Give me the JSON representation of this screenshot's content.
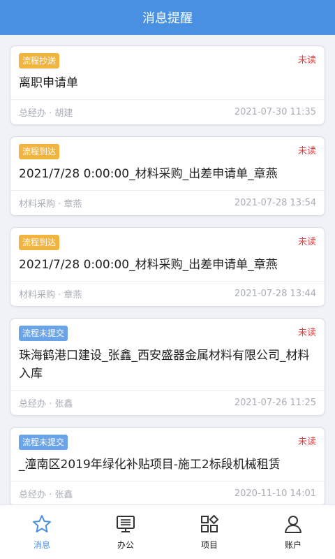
{
  "header": {
    "title": "消息提醒"
  },
  "messages": [
    {
      "tag": "流程抄送",
      "tag_color": "#f2b441",
      "status": "未读",
      "title": "离职申请单",
      "meta": "总经办 · 胡建",
      "time": "2021-07-30 11:35"
    },
    {
      "tag": "流程到达",
      "tag_color": "#f2b441",
      "status": "未读",
      "title": "2021/7/28 0:00:00_材料采购_出差申请单_章燕",
      "meta": "材料采购 · 章燕",
      "time": "2021-07-28 13:54"
    },
    {
      "tag": "流程到达",
      "tag_color": "#f2b441",
      "status": "未读",
      "title": "2021/7/28 0:00:00_材料采购_出差申请单_章燕",
      "meta": "材料采购 · 章燕",
      "time": "2021-07-28 13:44"
    },
    {
      "tag": "流程未提交",
      "tag_color": "#6aa3e8",
      "status": "未读",
      "title": "珠海鹤港口建设_张鑫_西安盛器金属材料有限公司_材料入库",
      "meta": "总经办 · 张鑫",
      "time": "2021-07-26 11:25"
    },
    {
      "tag": "流程未提交",
      "tag_color": "#6aa3e8",
      "status": "未读",
      "title": "_潼南区2019年绿化补贴项目-施工2标段机械租赁",
      "meta": "总经办 · 张鑫",
      "time": "2020-11-10 14:01"
    }
  ],
  "tabbar": {
    "items": [
      {
        "label": "消息",
        "icon": "star-icon",
        "active": true
      },
      {
        "label": "办公",
        "icon": "monitor-icon",
        "active": false
      },
      {
        "label": "项目",
        "icon": "grid-icon",
        "active": false
      },
      {
        "label": "账户",
        "icon": "user-icon",
        "active": false
      }
    ]
  },
  "colors": {
    "accent": "#4a90e2",
    "unread": "#e23d3d",
    "tag_orange": "#f2b441",
    "tag_blue": "#6aa3e8"
  }
}
